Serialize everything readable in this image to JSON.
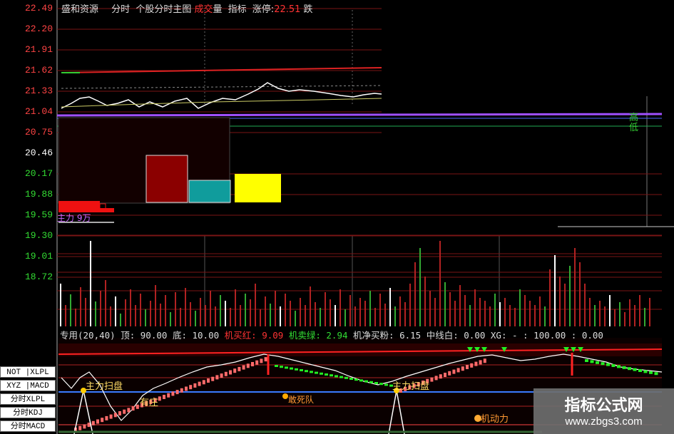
{
  "header": {
    "stock_name": "盛和资源",
    "tab_intraday": "分时",
    "tab_main": "个股分时主图",
    "tab_trade": "成交",
    "tab_volume": "量",
    "tab_indicator": "指标",
    "limit_up_label": "涨停:",
    "limit_up_value": "22.51",
    "limit_down_label": "跌"
  },
  "price_axis": [
    "22.49",
    "22.20",
    "21.91",
    "21.62",
    "21.33",
    "21.04",
    "20.75",
    "20.46",
    "20.17",
    "19.88",
    "19.59",
    "19.30",
    "19.01",
    "18.72"
  ],
  "chart_labels": {
    "high_label": "高",
    "low_label": "低",
    "main_force_label": "主力 9万"
  },
  "indicator_bar": {
    "name": "专用(20,40)",
    "top_label": "顶: 90.00",
    "bottom_label": "底: 10.00",
    "red_buy": "机买红: 9.09",
    "green_sell": "机卖绿: 2.94",
    "net_buy": "机净买粉: 6.15",
    "mid_line": "中线白: 0.00",
    "xg": "XG: - : 100.00 : 0.00"
  },
  "sub_chart_labels": {
    "sweep_1": "主力扫盘",
    "sweep_2": "主力扫盘",
    "bottom_signal": "有庄",
    "dare_to_chase": "敢死队",
    "momentum": "机动力"
  },
  "side_buttons": [
    "NOT |XLPL",
    "XYZ |MACD",
    "分时XLPL",
    "分时KDJ",
    "分时MACD"
  ],
  "watermark": {
    "title": "指标公式网",
    "url": "www.zbgs3.com"
  },
  "colors": {
    "red": "#ff3333",
    "green": "#33cc33",
    "grid": "#8a1a1a",
    "bg": "#000000"
  }
}
